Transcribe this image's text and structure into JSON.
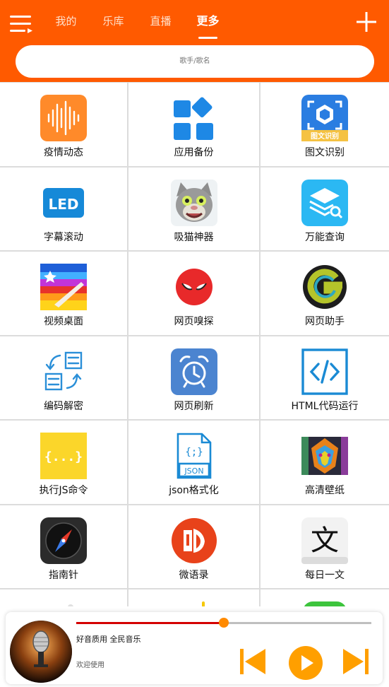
{
  "header": {
    "tabs": [
      {
        "label": "我的",
        "active": false
      },
      {
        "label": "乐库",
        "active": false
      },
      {
        "label": "直播",
        "active": false
      },
      {
        "label": "更多",
        "active": true
      }
    ],
    "search_placeholder": "歌手/歌名",
    "menu_icon": "menu-icon",
    "add_icon": "plus-icon"
  },
  "grid": {
    "items": [
      {
        "label": "疫情动态",
        "icon": "soundwave-icon"
      },
      {
        "label": "应用备份",
        "icon": "app-blocks-icon"
      },
      {
        "label": "图文识别",
        "icon": "scan-ocr-icon",
        "badge": "图文识别"
      },
      {
        "label": "字幕滚动",
        "icon": "led-icon",
        "badge": "LED"
      },
      {
        "label": "吸猫神器",
        "icon": "talking-cat-icon"
      },
      {
        "label": "万能查询",
        "icon": "layers-search-icon"
      },
      {
        "label": "视频桌面",
        "icon": "colorful-wallpaper-icon"
      },
      {
        "label": "网页嗅探",
        "icon": "spider-mask-icon"
      },
      {
        "label": "网页助手",
        "icon": "g-logo-icon"
      },
      {
        "label": "编码解密",
        "icon": "convert-docs-icon"
      },
      {
        "label": "网页刷新",
        "icon": "alarm-clock-icon"
      },
      {
        "label": "HTML代码运行",
        "icon": "code-brackets-icon"
      },
      {
        "label": "执行JS命令",
        "icon": "js-braces-icon",
        "badge": "{...}"
      },
      {
        "label": "json格式化",
        "icon": "json-file-icon",
        "badge": "JSON"
      },
      {
        "label": "高清壁纸",
        "icon": "lion-art-icon"
      },
      {
        "label": "指南针",
        "icon": "compass-icon"
      },
      {
        "label": "微语录",
        "icon": "book-logo-icon"
      },
      {
        "label": "每日一文",
        "icon": "wen-character-icon",
        "badge": "文"
      },
      {
        "label": "",
        "icon": "partial-icon"
      },
      {
        "label": "",
        "icon": "partial-icon"
      },
      {
        "label": "",
        "icon": "partial-icon"
      }
    ]
  },
  "player": {
    "title": "好音质用 全民音乐",
    "subtitle": "欢迎使用",
    "progress": 0.5,
    "cover_icon": "microphone-cover-icon",
    "prev_icon": "previous-icon",
    "play_icon": "play-icon",
    "next_icon": "next-icon"
  },
  "colors": {
    "brand": "#ff5a00",
    "accent": "#ff9f00",
    "progress_played": "#d40000"
  }
}
